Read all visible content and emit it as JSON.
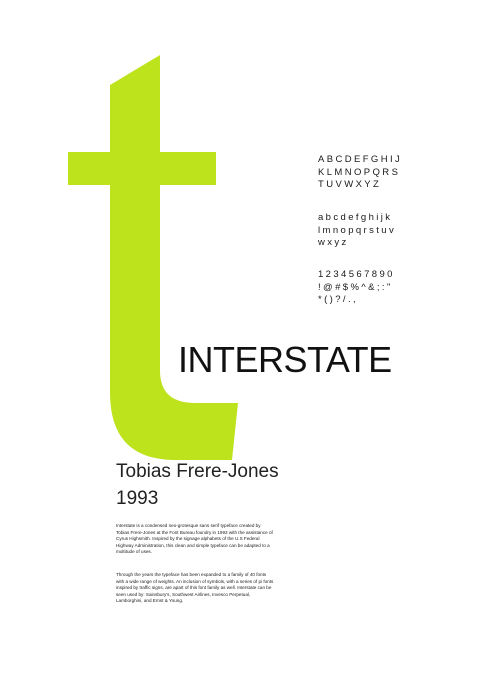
{
  "colors": {
    "accent": "#bde31d",
    "background": "#ffffff",
    "text": "#1a1a1a"
  },
  "uppercase_lines": [
    "ABCDEFGHIJ",
    "KLMNOPQRS",
    "TUVWXYZ"
  ],
  "lowercase_lines": [
    "abcdefghijk",
    "lmnopqrstuv",
    "wxyz"
  ],
  "numbers_symbols_lines": [
    "1234567890",
    "!@#$%^&;:\"",
    "*()?/.,"
  ],
  "title": "INTERSTATE",
  "designer": "Tobias Frere-Jones",
  "year": "1993",
  "paragraph_1": "Interstate is a condensed neo-grotesque sans serif typeface created by Tobias Frere-Jones at the Font Bureau foundry in 1993 with the assistance of Cyrus Highsmith. Inspired by the signage alphabets of the U.S Federal Highway Administration, this clean and simple typeface can be adapted to a multitude of uses.",
  "paragraph_2": "Through the years the typeface has been expanded to a family of 40 fonts with a wide range of weights. An inclusion of symbols, with a series of pi fonts inspired by traffic signs, are apart of this font family as well. Interstate can be seen used by: Sainsbury's, Southwest Airlines, Invesco Perpetual, Lamborghini, and Ernst & Young."
}
